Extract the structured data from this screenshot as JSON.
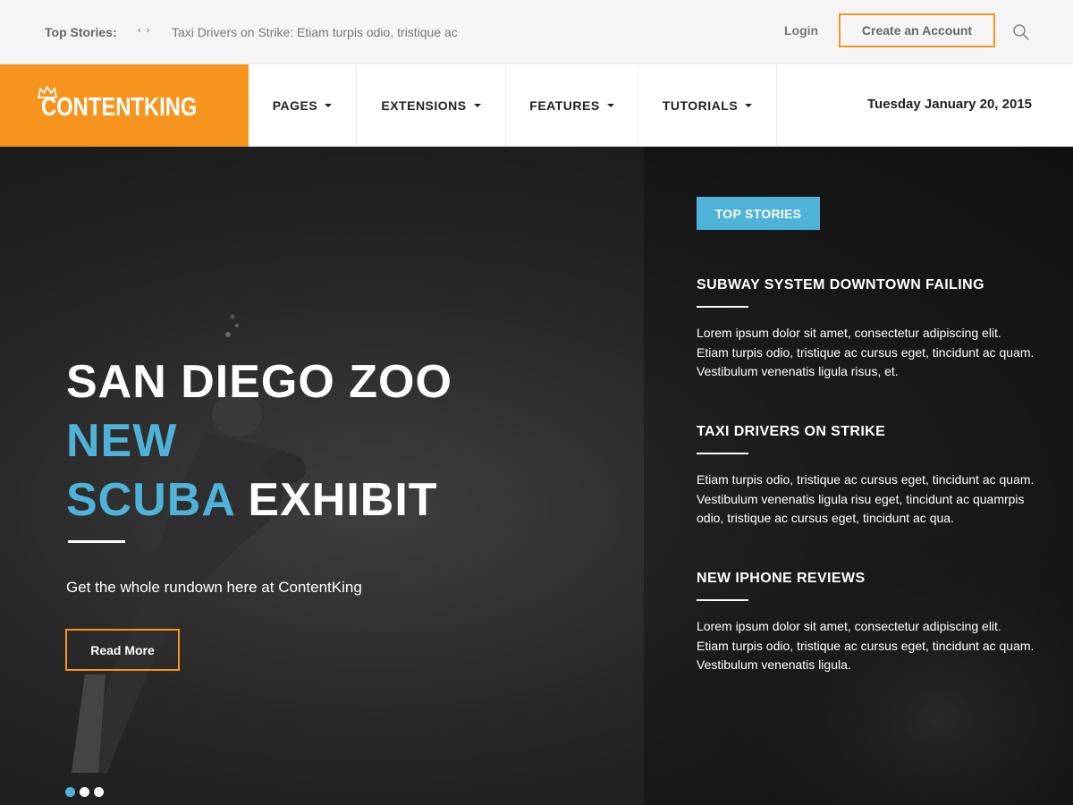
{
  "topbar": {
    "top_stories_label": "Top Stories:",
    "prev_arrow": "‹",
    "next_arrow": "›",
    "ticker_headline": "Taxi Drivers on Strike: Etiam turpis odio, tristique ac",
    "login_label": "Login",
    "create_account_label": "Create an Account",
    "search_icon": "search-icon"
  },
  "navbar": {
    "logo_text": "CONTENTKING",
    "logo_icon": "crown-icon",
    "items": [
      {
        "label": "PAGES"
      },
      {
        "label": "EXTENSIONS"
      },
      {
        "label": "FEATURES"
      },
      {
        "label": "TUTORIALS"
      }
    ],
    "date": "Tuesday January 20, 2015"
  },
  "hero": {
    "title_line1": "SAN DIEGO ZOO",
    "title_line2": "NEW",
    "title_line3_blue": "SCUBA",
    "title_line3_white": "EXHIBIT",
    "subtitle": "Get the whole rundown here at ContentKing",
    "read_more_label": "Read More",
    "slides_total": 3,
    "active_slide": 1
  },
  "top_stories": {
    "badge_label": "TOP STORIES",
    "stories": [
      {
        "title": "SUBWAY SYSTEM DOWNTOWN FAILING",
        "body": "Lorem ipsum dolor sit amet, consectetur adipiscing elit. Etiam turpis odio, tristique ac cursus eget, tincidunt ac quam. Vestibulum venenatis ligula risus, et."
      },
      {
        "title": "TAXI DRIVERS ON STRIKE",
        "body": "Etiam turpis odio, tristique ac cursus eget, tincidunt ac quam. Vestibulum venenatis ligula risu eget, tincidunt ac quamrpis odio, tristique ac cursus eget, tincidunt ac qua."
      },
      {
        "title": "NEW IPHONE REVIEWS",
        "body": "Lorem ipsum dolor sit amet, consectetur adipiscing elit. Etiam turpis odio, tristique ac cursus eget, tincidunt ac quam. Vestibulum venenatis ligula."
      }
    ]
  },
  "colors": {
    "brand_orange": "#f7941d",
    "accent_blue": "#4fb3d9"
  }
}
